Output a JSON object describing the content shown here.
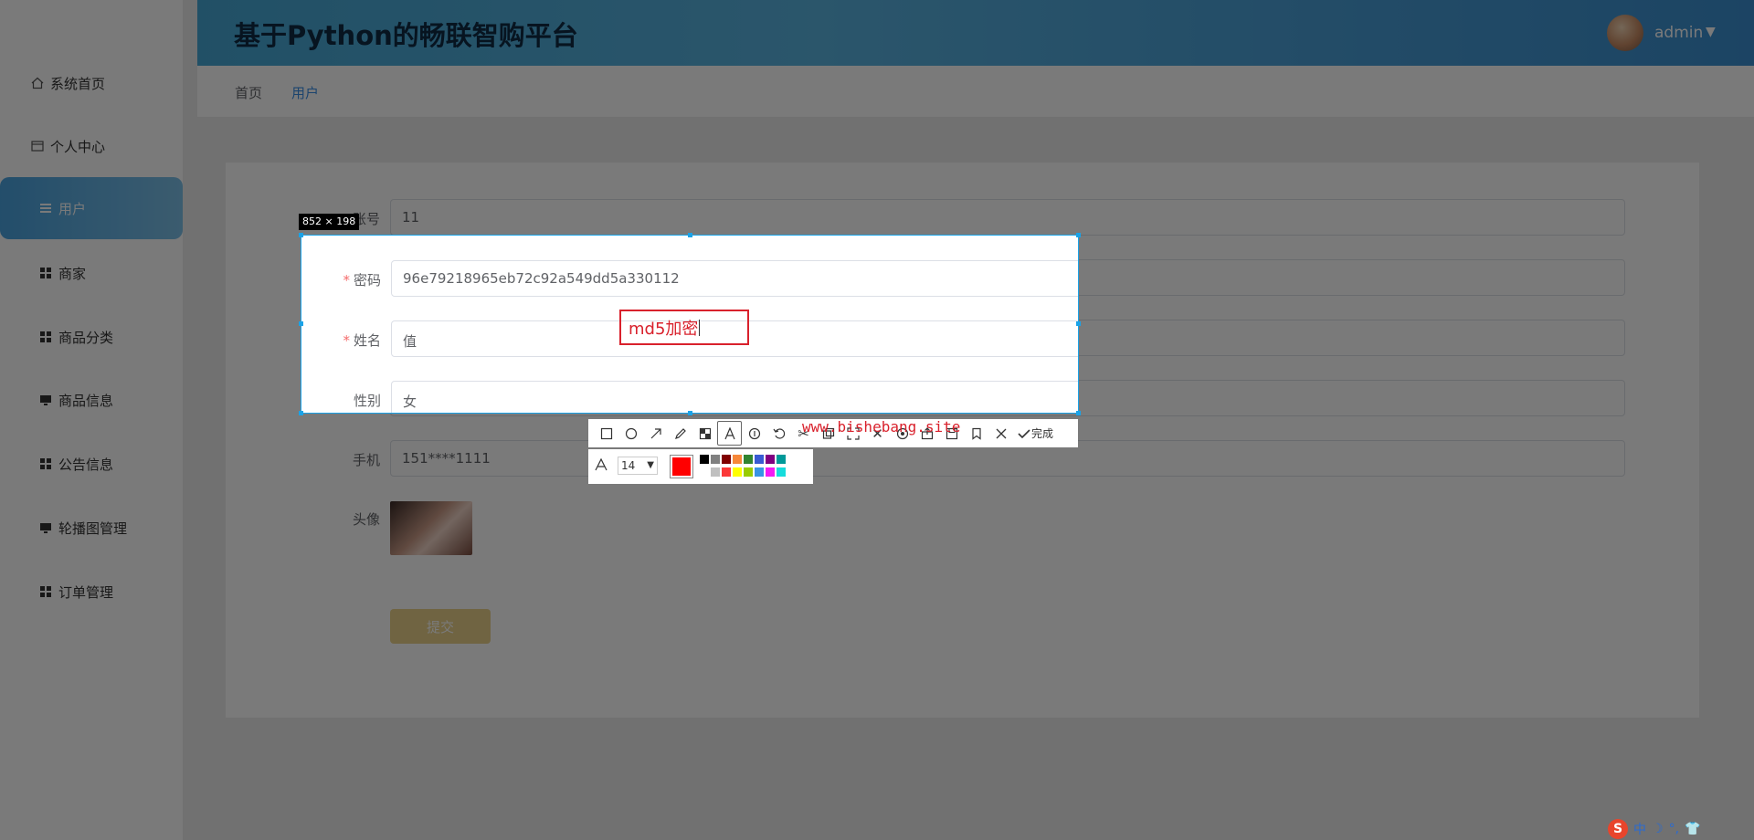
{
  "header": {
    "title": "基于Python的畅联智购平台",
    "user_name": "admin"
  },
  "sidebar": {
    "items": [
      {
        "label": "系统首页",
        "icon": "home-icon"
      },
      {
        "label": "个人中心",
        "icon": "profile-card-icon"
      },
      {
        "label": "用户",
        "icon": "list-icon",
        "active": true
      },
      {
        "label": "商家",
        "icon": "grid-icon"
      },
      {
        "label": "商品分类",
        "icon": "grid-icon"
      },
      {
        "label": "商品信息",
        "icon": "monitor-icon"
      },
      {
        "label": "公告信息",
        "icon": "grid-icon"
      },
      {
        "label": "轮播图管理",
        "icon": "monitor-icon"
      },
      {
        "label": "订单管理",
        "icon": "grid-icon"
      }
    ]
  },
  "breadcrumb": {
    "home": "首页",
    "current": "用户"
  },
  "form": {
    "account": {
      "label": "账号",
      "value": "11"
    },
    "password": {
      "label": "密码",
      "value": "96e79218965eb72c92a549dd5a330112"
    },
    "name": {
      "label": "姓名",
      "value": "值"
    },
    "gender": {
      "label": "性别",
      "value": "女"
    },
    "phone": {
      "label": "手机",
      "value": "151****1111"
    },
    "avatar": {
      "label": "头像"
    },
    "submit_label": "提交"
  },
  "screenshot_tool": {
    "selection_size": "852 × 198",
    "annotation_text": "md5加密",
    "watermark": "www.bishebang.site",
    "done_label": "完成",
    "font_size": "14",
    "current_color": "#ff0000",
    "swatches_top": [
      "#000000",
      "#808080",
      "#800000",
      "#f7883a",
      "#308430",
      "#385ad3",
      "#800080",
      "#009999"
    ],
    "swatches_bottom": [
      "#ffffff",
      "#c0c0c0",
      "#fb3838",
      "#ffff00",
      "#99cc00",
      "#3894e4",
      "#f31bf3",
      "#16dcdc"
    ]
  },
  "tray": {
    "ime_label": "中"
  }
}
